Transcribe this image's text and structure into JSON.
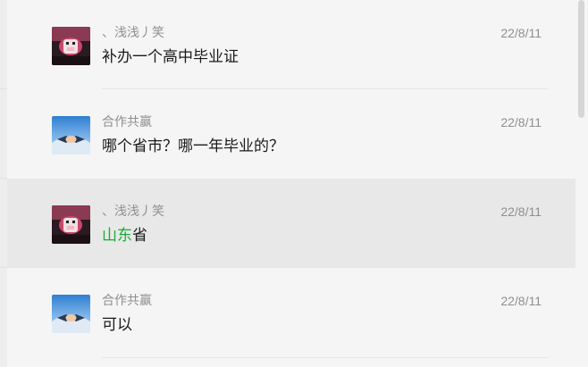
{
  "messages": [
    {
      "sender": "、浅浅丿笑",
      "date": "22/8/11",
      "text": "补办一个高中毕业证",
      "avatar": "anime-character-avatar"
    },
    {
      "sender": "合作共赢",
      "date": "22/8/11",
      "text": "哪个省市？哪一年毕业的？",
      "avatar": "handshake-avatar"
    },
    {
      "sender": "、浅浅丿笑",
      "date": "22/8/11",
      "text_highlight": "山东",
      "text_rest": "省",
      "highlight_color": "#1aab37",
      "avatar": "anime-character-avatar"
    },
    {
      "sender": "合作共赢",
      "date": "22/8/11",
      "text": "可以",
      "avatar": "handshake-avatar"
    }
  ]
}
